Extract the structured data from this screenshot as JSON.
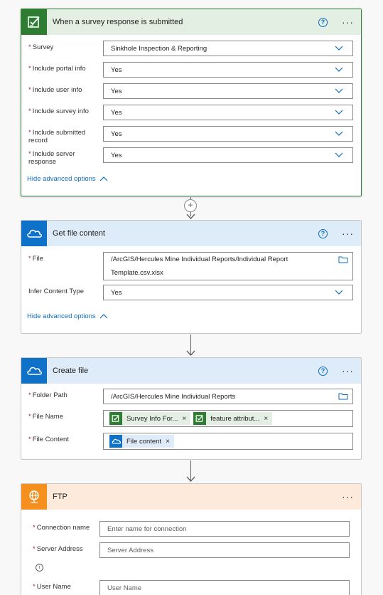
{
  "survey_card": {
    "title": "When a survey response is submitted",
    "help": "?",
    "more": "···",
    "fields": [
      {
        "label": "Survey",
        "value": "Sinkhole Inspection & Reporting"
      },
      {
        "label": "Include portal info",
        "value": "Yes"
      },
      {
        "label": "Include user info",
        "value": "Yes"
      },
      {
        "label": "Include survey info",
        "value": "Yes"
      },
      {
        "label": "Include submitted record",
        "value": "Yes"
      },
      {
        "label": "Include server response",
        "value": "Yes"
      }
    ],
    "advanced_link": "Hide advanced options"
  },
  "getfile_card": {
    "title": "Get file content",
    "help": "?",
    "more": "···",
    "file_label": "File",
    "file_value_line1": "/ArcGIS/Hercules Mine Individual Reports/Individual Report",
    "file_value_line2": "Template.csv.xlsx",
    "infer_label": "Infer Content Type",
    "infer_value": "Yes",
    "advanced_link": "Hide advanced options"
  },
  "createfile_card": {
    "title": "Create file",
    "help": "?",
    "more": "···",
    "folder_label": "Folder Path",
    "folder_value": "/ArcGIS/Hercules Mine Individual Reports",
    "filename_label": "File Name",
    "filename_tokens": [
      "Survey Info For...",
      "feature attribut..."
    ],
    "content_label": "File Content",
    "content_token": "File content",
    "token_remove": "×"
  },
  "ftp_card": {
    "title": "FTP",
    "more": "···",
    "connection_label": "Connection name",
    "connection_placeholder": "Enter name for connection",
    "server_label": "Server Address",
    "server_placeholder": "Server Address",
    "user_label": "User Name",
    "user_placeholder": "User Name"
  },
  "required_mark": "*",
  "plus": "+",
  "info": "i",
  "colors": {
    "survey_accent": "#2e7d32",
    "onedrive_accent": "#0f72c8",
    "ftp_accent": "#f5901e",
    "link": "#0f6cbd",
    "required": "#a4262c"
  }
}
